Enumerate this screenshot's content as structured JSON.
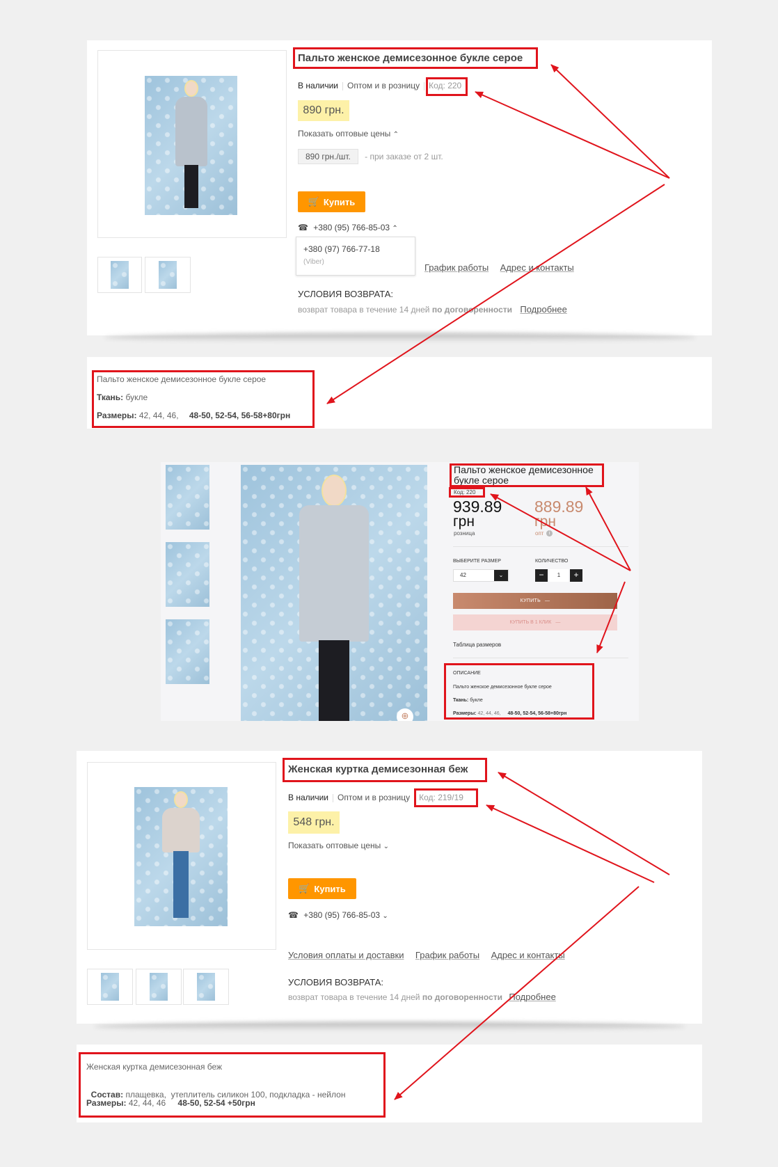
{
  "product1": {
    "title": "Пальто женское демисезонное букле серое",
    "availability": "В наличии",
    "sale_type": "Оптом и в розницу",
    "code": "Код: 220",
    "price": "890 грн.",
    "show_wholesale": "Показать оптовые цены",
    "wholesale_price": "890 грн./шт.",
    "wholesale_note": "- при заказе от 2 шт.",
    "buy_label": "Купить",
    "phone": "+380 (95) 766-85-03",
    "phone2": "+380 (97) 766-77-18",
    "phone2_note": "(Viber)",
    "link_schedule": "График работы",
    "link_contacts": "Адрес и контакты",
    "returns_heading": "УСЛОВИЯ ВОЗВРАТА:",
    "returns_text": "возврат товара в течение 14 дней",
    "returns_bold": "по договоренности",
    "more_link": "Подробнее"
  },
  "desc1": {
    "title": "Пальто женское демисезонное букле серое",
    "fabric_label": "Ткань:",
    "fabric_value": "букле",
    "sizes_label": "Размеры:",
    "sizes_value": "42, 44, 46,",
    "sizes_extra": "48-50, 52-54, 56-58+80грн"
  },
  "competitor": {
    "title": "Пальто женское демисезонное букле серое",
    "code": "Код: 220",
    "retail_price": "939.89",
    "retail_currency": "грн",
    "retail_label": "розница",
    "opt_price": "889.89",
    "opt_currency": "грн",
    "opt_label": "опт",
    "size_label": "ВЫБЕРИТЕ РАЗМЕР",
    "size_value": "42",
    "qty_label": "КОЛИЧЕСТВО",
    "qty_value": "1",
    "buy_label": "КУПИТЬ",
    "one_click_label": "КУПИТЬ В 1 КЛИК",
    "size_table": "Таблица размеров",
    "desc_heading": "ОПИСАНИЕ",
    "desc_title": "Пальто женское демисезонное букле серое",
    "fabric_label": "Ткань:",
    "fabric_value": "букле",
    "sizes_label": "Размеры:",
    "sizes_value": "42, 44, 46,",
    "sizes_extra": "48-50, 52-54, 56-58+80грн"
  },
  "product2": {
    "title": "Женская куртка демисезонная беж",
    "availability": "В наличии",
    "sale_type": "Оптом и в розницу",
    "code": "Код: 219/19",
    "price": "548 грн.",
    "show_wholesale": "Показать оптовые цены",
    "buy_label": "Купить",
    "phone": "+380 (95) 766-85-03",
    "link_payment": "Условия оплаты и доставки",
    "link_schedule": "График работы",
    "link_contacts": "Адрес и контакты",
    "returns_heading": "УСЛОВИЯ ВОЗВРАТА:",
    "returns_text": "возврат товара в течение 14 дней",
    "returns_bold": "по договоренности",
    "more_link": "Подробнее"
  },
  "desc2": {
    "title": "Женская куртка демисезонная беж",
    "composition_label": "Состав:",
    "composition_value": "плащевка,  утеплитель силикон 100, подкладка - нейлон",
    "sizes_label": "Размеры:",
    "sizes_value": "42, 44, 46",
    "sizes_extra": "48-50, 52-54 +50грн"
  },
  "colors": {
    "highlight_red": "#e0141c",
    "buy_orange": "#ff9600",
    "price_yellow": "#fdf1a8",
    "copper": "#b77a5e"
  }
}
